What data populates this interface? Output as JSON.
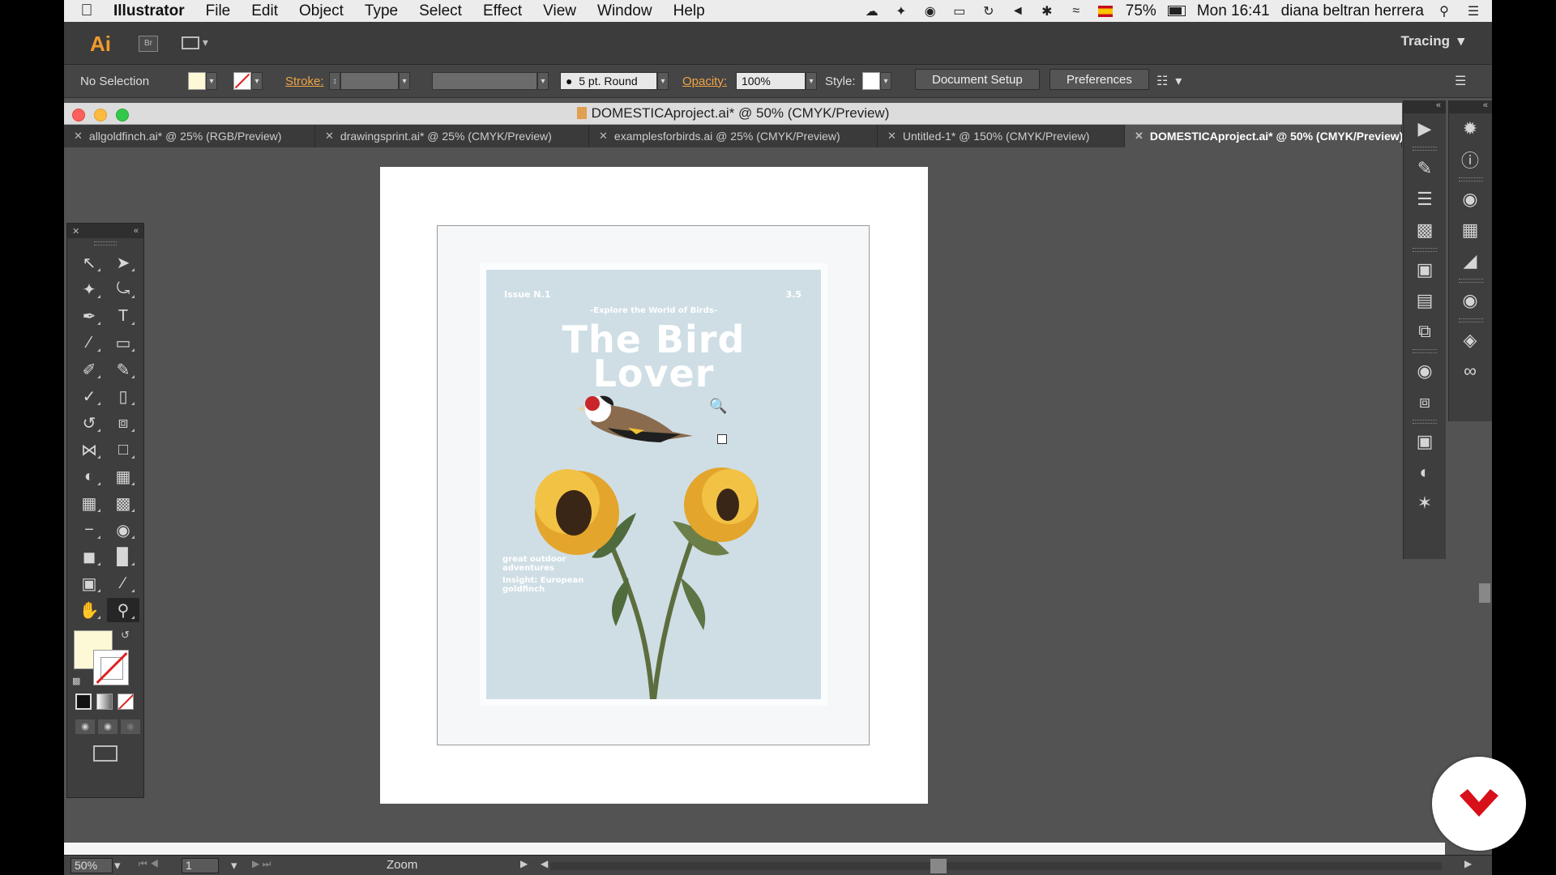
{
  "menubar": {
    "app": "Illustrator",
    "items": [
      "File",
      "Edit",
      "Object",
      "Type",
      "Select",
      "Effect",
      "View",
      "Window",
      "Help"
    ],
    "battery": "75%",
    "clock": "Mon 16:41",
    "user": "diana beltran herrera"
  },
  "appbar": {
    "logo": "Ai",
    "bridge": "Br",
    "workspace": "Tracing"
  },
  "control": {
    "selection": "No Selection",
    "stroke_label": "Stroke:",
    "brush": "5 pt. Round",
    "opacity_label": "Opacity:",
    "opacity": "100%",
    "style_label": "Style:",
    "doc_setup": "Document Setup",
    "preferences": "Preferences"
  },
  "document": {
    "title": "DOMESTICAproject.ai* @ 50% (CMYK/Preview)",
    "tabs": [
      "allgoldfinch.ai* @ 25% (RGB/Preview)",
      "drawingsprint.ai* @ 25% (CMYK/Preview)",
      "examplesforbirds.ai @ 25% (CMYK/Preview)",
      "Untitled-1* @ 150% (CMYK/Preview)",
      "DOMESTICAproject.ai* @ 50% (CMYK/Preview)"
    ]
  },
  "cover": {
    "issue": "Issue N.1",
    "price": "3.5",
    "tagline": "-Explore the World of Birds-",
    "title_line1": "The Bird",
    "title_line2": "Lover",
    "bottom1": "great outdoor adventures",
    "bottom2": "Insight: European goldfinch"
  },
  "status": {
    "zoom": "50%",
    "page": "1",
    "tool": "Zoom"
  },
  "colors": {
    "accent": "#f19a2b",
    "fill": "#fdf8d6",
    "cover_bg": "#cfdee5",
    "brand": "#d8101a"
  }
}
